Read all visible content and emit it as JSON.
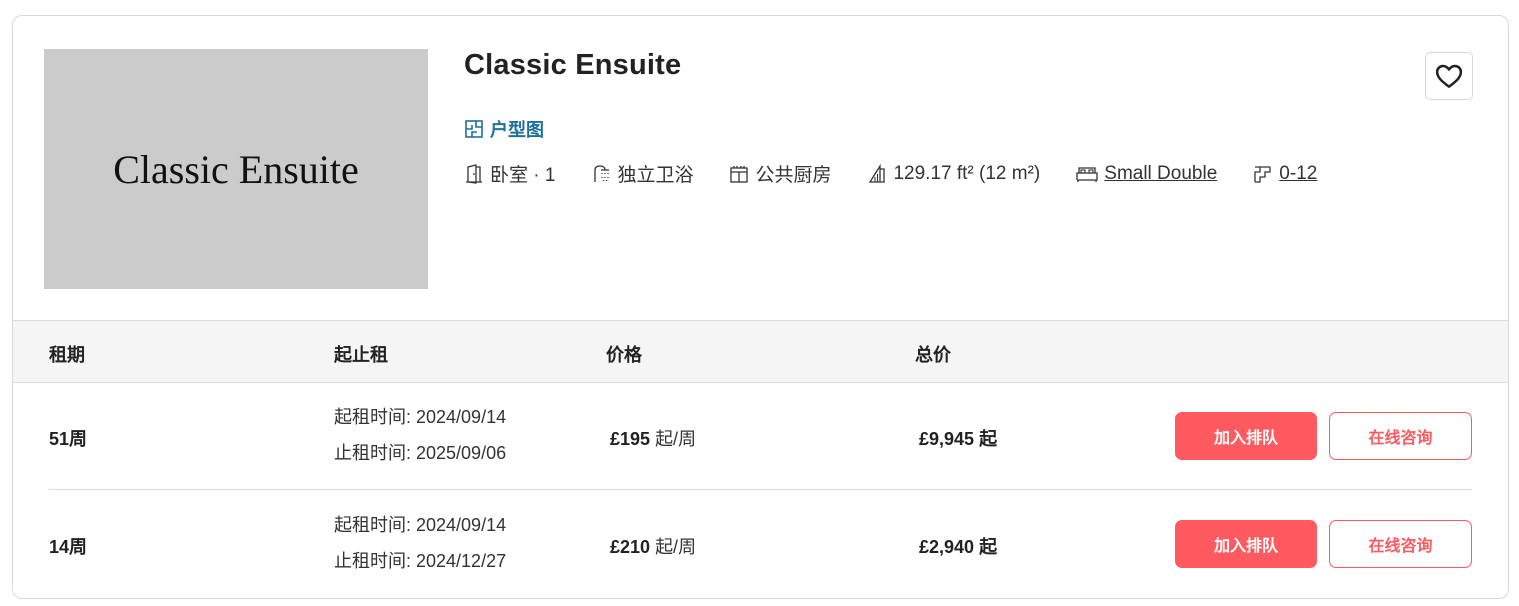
{
  "room": {
    "image_text": "Classic Ensuite",
    "title": "Classic Ensuite",
    "floorplan_label": "户型图"
  },
  "features": [
    {
      "icon": "door-icon",
      "text": "卧室 · 1",
      "link": false
    },
    {
      "icon": "shower-icon",
      "text": "独立卫浴",
      "link": false
    },
    {
      "icon": "kitchen-icon",
      "text": "公共厨房",
      "link": false
    },
    {
      "icon": "area-icon",
      "text": "129.17 ft² (12 m²)",
      "link": false
    },
    {
      "icon": "bed-icon",
      "text": "Small Double",
      "link": true
    },
    {
      "icon": "stairs-icon",
      "text": "0-12",
      "link": true
    }
  ],
  "table": {
    "headers": [
      "租期",
      "起止租",
      "价格",
      "总价"
    ],
    "rows": [
      {
        "term": "51周",
        "start": "起租时间: 2024/09/14",
        "end": "止租时间: 2025/09/06",
        "price": "£195",
        "price_unit": "起/周",
        "total": "£9,945",
        "total_unit": "起",
        "join_label": "加入排队",
        "chat_label": "在线咨询"
      },
      {
        "term": "14周",
        "start": "起租时间: 2024/09/14",
        "end": "止租时间: 2024/12/27",
        "price": "£210",
        "price_unit": "起/周",
        "total": "£2,940",
        "total_unit": "起",
        "join_label": "加入排队",
        "chat_label": "在线咨询"
      }
    ]
  },
  "colors": {
    "accent": "#ff5a60",
    "link_blue": "#1f6f9b",
    "header_bg": "#f5f5f5"
  }
}
